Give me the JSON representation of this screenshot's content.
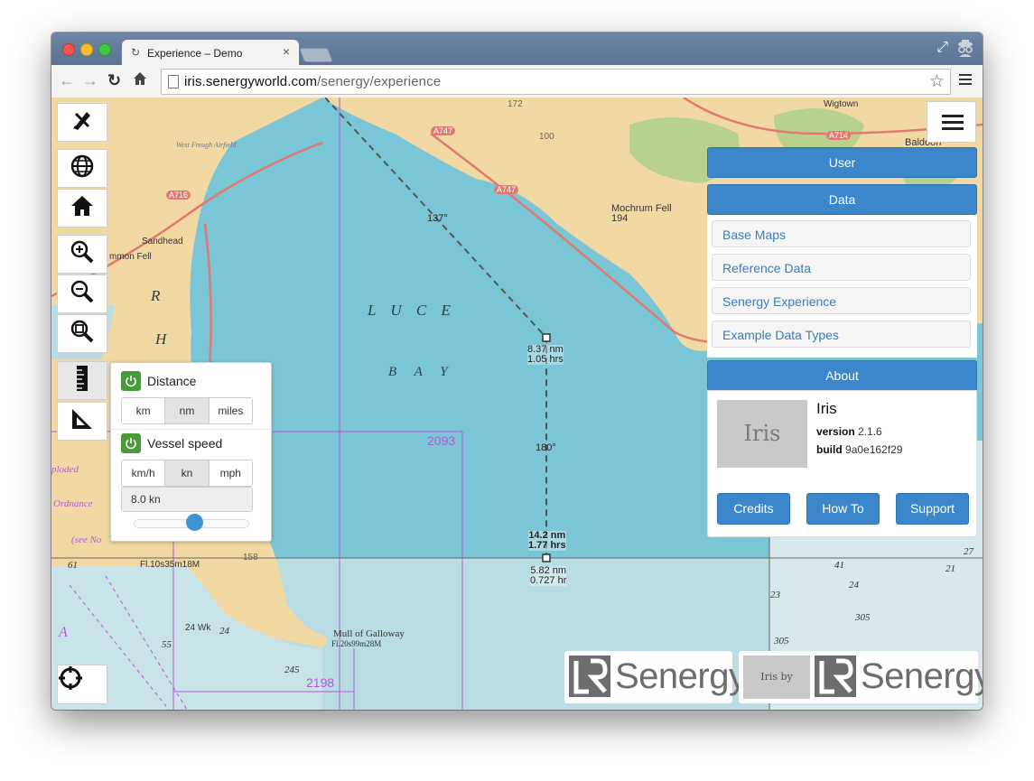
{
  "browser": {
    "tab_title": "Experience – Demo",
    "tab_close": "×",
    "url_host": "iris.senergyworld.com",
    "url_path": "/senergy/experience"
  },
  "map": {
    "bay_name_1": "L  U  C  E",
    "bay_name_2": "B  A  Y",
    "bearing_1": "137°",
    "bearing_2": "180°",
    "leg1_distance": "8.37 nm",
    "leg1_time": "1.05 hrs",
    "total_distance": "14.2 nm",
    "total_time": "1.77 hrs",
    "leg2_distance": "5.82 nm",
    "leg2_time": "0.727 hr",
    "chart_number_1": "2093",
    "chart_number_2": "2198",
    "place_mochrum_fell": "Mochrum Fell",
    "place_mochrum_height": "194",
    "place_sandhead": "Sandhead",
    "place_mmon_fell": "mmon Fell",
    "place_wigtown": "Wigtown",
    "place_baldoon": "Baldoon",
    "place_mull": "Mull of Galloway",
    "place_mull_light": "Fl.20s99m28M",
    "place_west_freugh": "West Freugh Airfield",
    "road_a747": "A747",
    "road_a716": "A716",
    "road_a714": "A714",
    "road_a747b": "A747",
    "depth_1": "172",
    "depth_2": "100",
    "depth_3": "158",
    "light_1": "Fl.10s35m18M",
    "exploded": "ploded",
    "ordnance": "Ordnance",
    "see_note": "(see No",
    "letter_r": "R",
    "letter_h": "H",
    "letter_a": "A",
    "letter_bay_s": "24 Wk",
    "sounding_1": "61",
    "sounding_2": "55",
    "sounding_3": "24",
    "sounding_4": "245",
    "sounding_5": "41",
    "sounding_6": "27",
    "sounding_7": "21",
    "sounding_8": "23",
    "sounding_9": "305",
    "sounding_10": "305",
    "sounding_11": "24"
  },
  "measure_panel": {
    "distance_label": "Distance",
    "distance_units": [
      "km",
      "nm",
      "miles"
    ],
    "distance_selected": "nm",
    "speed_label": "Vessel speed",
    "speed_units": [
      "km/h",
      "kn",
      "mph"
    ],
    "speed_selected": "kn",
    "speed_value": "8.0 kn",
    "speed_slider_fraction": 0.53
  },
  "side_panel": {
    "user_label": "User",
    "data_label": "Data",
    "data_items": [
      "Base Maps",
      "Reference Data",
      "Senergy Experience",
      "Example Data Types"
    ],
    "about_label": "About",
    "app_logo_text": "Iris",
    "app_name": "Iris",
    "version_label": "version",
    "version_value": "2.1.6",
    "build_label": "build",
    "build_value": "9a0e162f29",
    "credits_label": "Credits",
    "howto_label": "How To",
    "support_label": "Support"
  },
  "branding": {
    "company": "Senergy",
    "iris_by": "Iris by",
    "company_2": "Senergy"
  },
  "colors": {
    "sea": "#7ac6d6",
    "land": "#f2d8a3",
    "accent_blue": "#3c87cb",
    "power_green": "#4a9a3b",
    "chart_magenta": "#b45ad2"
  },
  "icons": {
    "draw": "pencil-ruler-icon",
    "globe": "globe-icon",
    "home": "home-icon",
    "zoom_in": "zoom-in-icon",
    "zoom_out": "zoom-out-icon",
    "zoom_extent": "zoom-extent-icon",
    "ruler": "ruler-icon",
    "triangle": "set-square-icon",
    "target": "crosshair-icon"
  }
}
